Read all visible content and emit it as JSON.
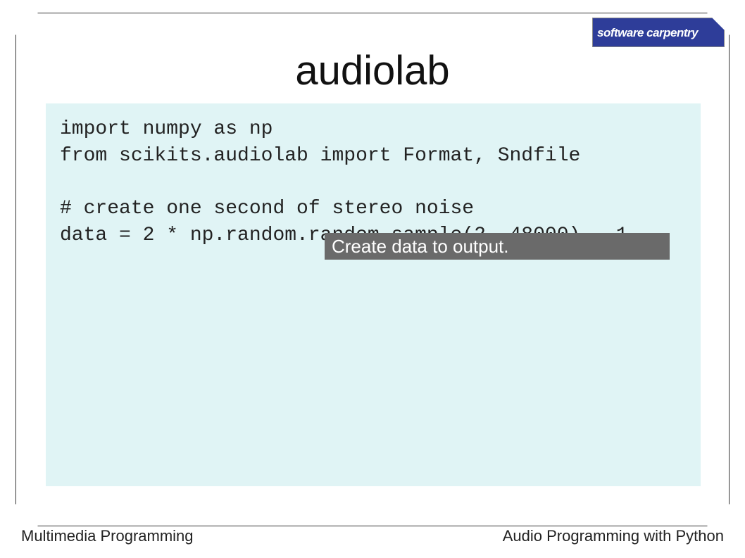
{
  "logo": {
    "line1": "software carpentry",
    "line2": ""
  },
  "title": "audiolab",
  "code": "import numpy as np\nfrom scikits.audiolab import Format, Sndfile\n\n# create one second of stereo noise\ndata = 2 * np.random.random_sample(2, 48000) – 1",
  "callout": "Create data to output.",
  "footer": {
    "left": "Multimedia Programming",
    "right": "Audio Programming with Python"
  }
}
